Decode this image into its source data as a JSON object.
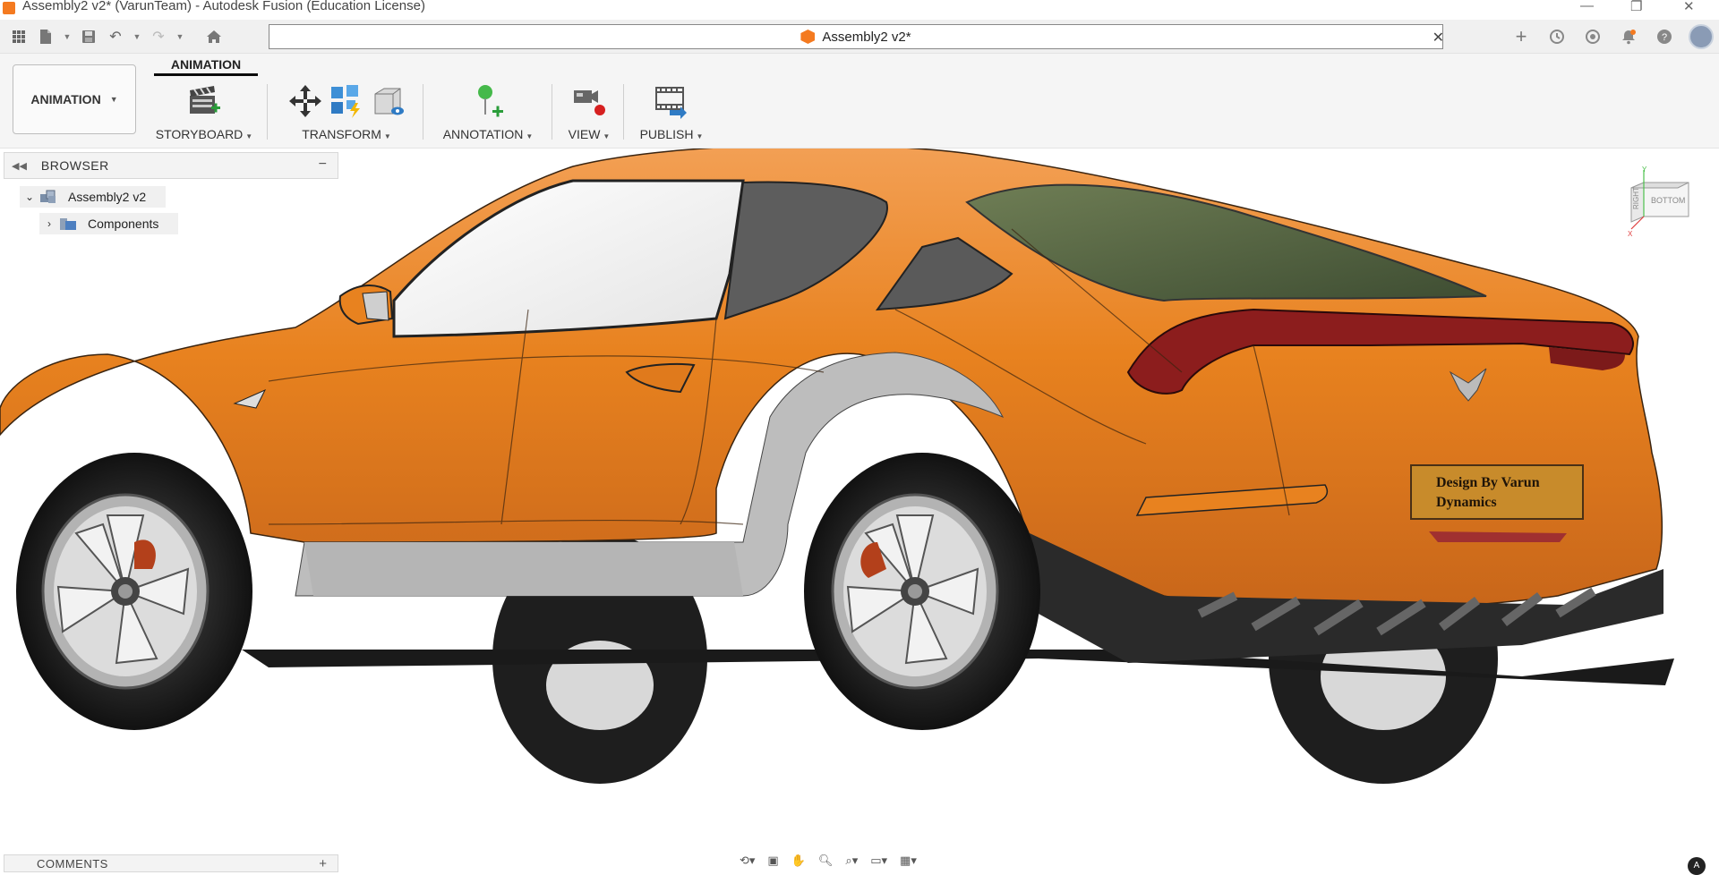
{
  "window": {
    "title": "Assembly2 v2* (VarunTeam) - Autodesk Fusion (Education License)"
  },
  "document_tab": {
    "label": "Assembly2 v2*"
  },
  "ribbon": {
    "workspace": "ANIMATION",
    "active_tab": "ANIMATION",
    "groups": [
      {
        "label": "STORYBOARD"
      },
      {
        "label": "TRANSFORM"
      },
      {
        "label": "ANNOTATION"
      },
      {
        "label": "VIEW"
      },
      {
        "label": "PUBLISH"
      }
    ]
  },
  "browser": {
    "title": "BROWSER",
    "root": {
      "label": "Assembly2 v2"
    },
    "children": [
      {
        "label": "Components"
      }
    ]
  },
  "comments": {
    "title": "COMMENTS"
  },
  "viewcube": {
    "right_face": "RIGHT",
    "bottom_face": "BOTTOM",
    "axis_x": "X",
    "axis_y": "Y"
  },
  "model": {
    "plate_text_line1": "Design By Varun",
    "plate_text_line2": "Dynamics",
    "body_color": "#e8821f"
  },
  "icons": {
    "apps": "grid-icon",
    "file": "file-icon",
    "save": "save-icon",
    "undo": "undo-icon",
    "redo": "redo-icon",
    "home": "home-icon",
    "new_tab": "plus-icon",
    "extensions": "clock-icon",
    "jobs": "status-icon",
    "notifications": "bell-icon",
    "help": "help-icon"
  }
}
